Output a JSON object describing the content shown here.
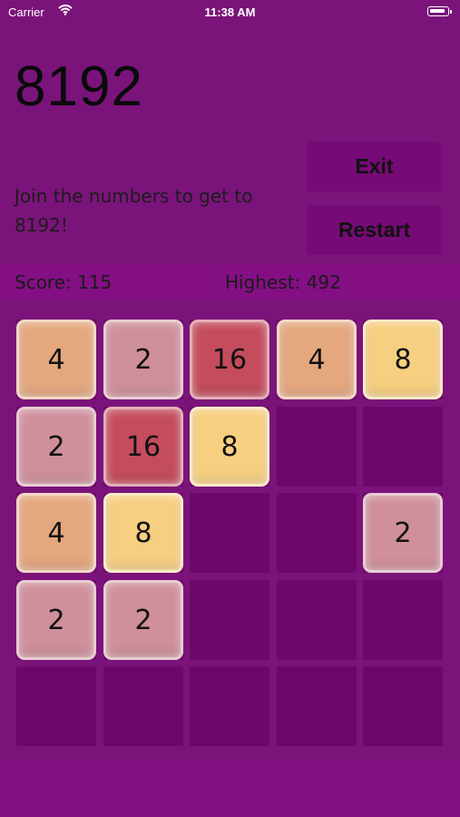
{
  "status_bar": {
    "carrier": "Carrier",
    "time": "11:38 AM"
  },
  "header": {
    "title": "8192",
    "subtitle": "Join the numbers to get to 8192!"
  },
  "buttons": {
    "exit": "Exit",
    "restart": "Restart"
  },
  "scores": {
    "score_label": "Score: 115",
    "highest_label": "Highest: 492"
  },
  "board": {
    "rows": 5,
    "cols": 5,
    "grid": [
      [
        "4",
        "2",
        "16",
        "4",
        "8"
      ],
      [
        "2",
        "16",
        "8",
        "",
        ""
      ],
      [
        "4",
        "8",
        "",
        "",
        "2"
      ],
      [
        "2",
        "2",
        "",
        "",
        ""
      ],
      [
        "",
        "",
        "",
        "",
        ""
      ]
    ]
  },
  "colors": {
    "background": "#7a147a",
    "tile_2": "#cf8f9b",
    "tile_4": "#e4a77e",
    "tile_8": "#f7cf80",
    "tile_16": "#c44c5c"
  }
}
